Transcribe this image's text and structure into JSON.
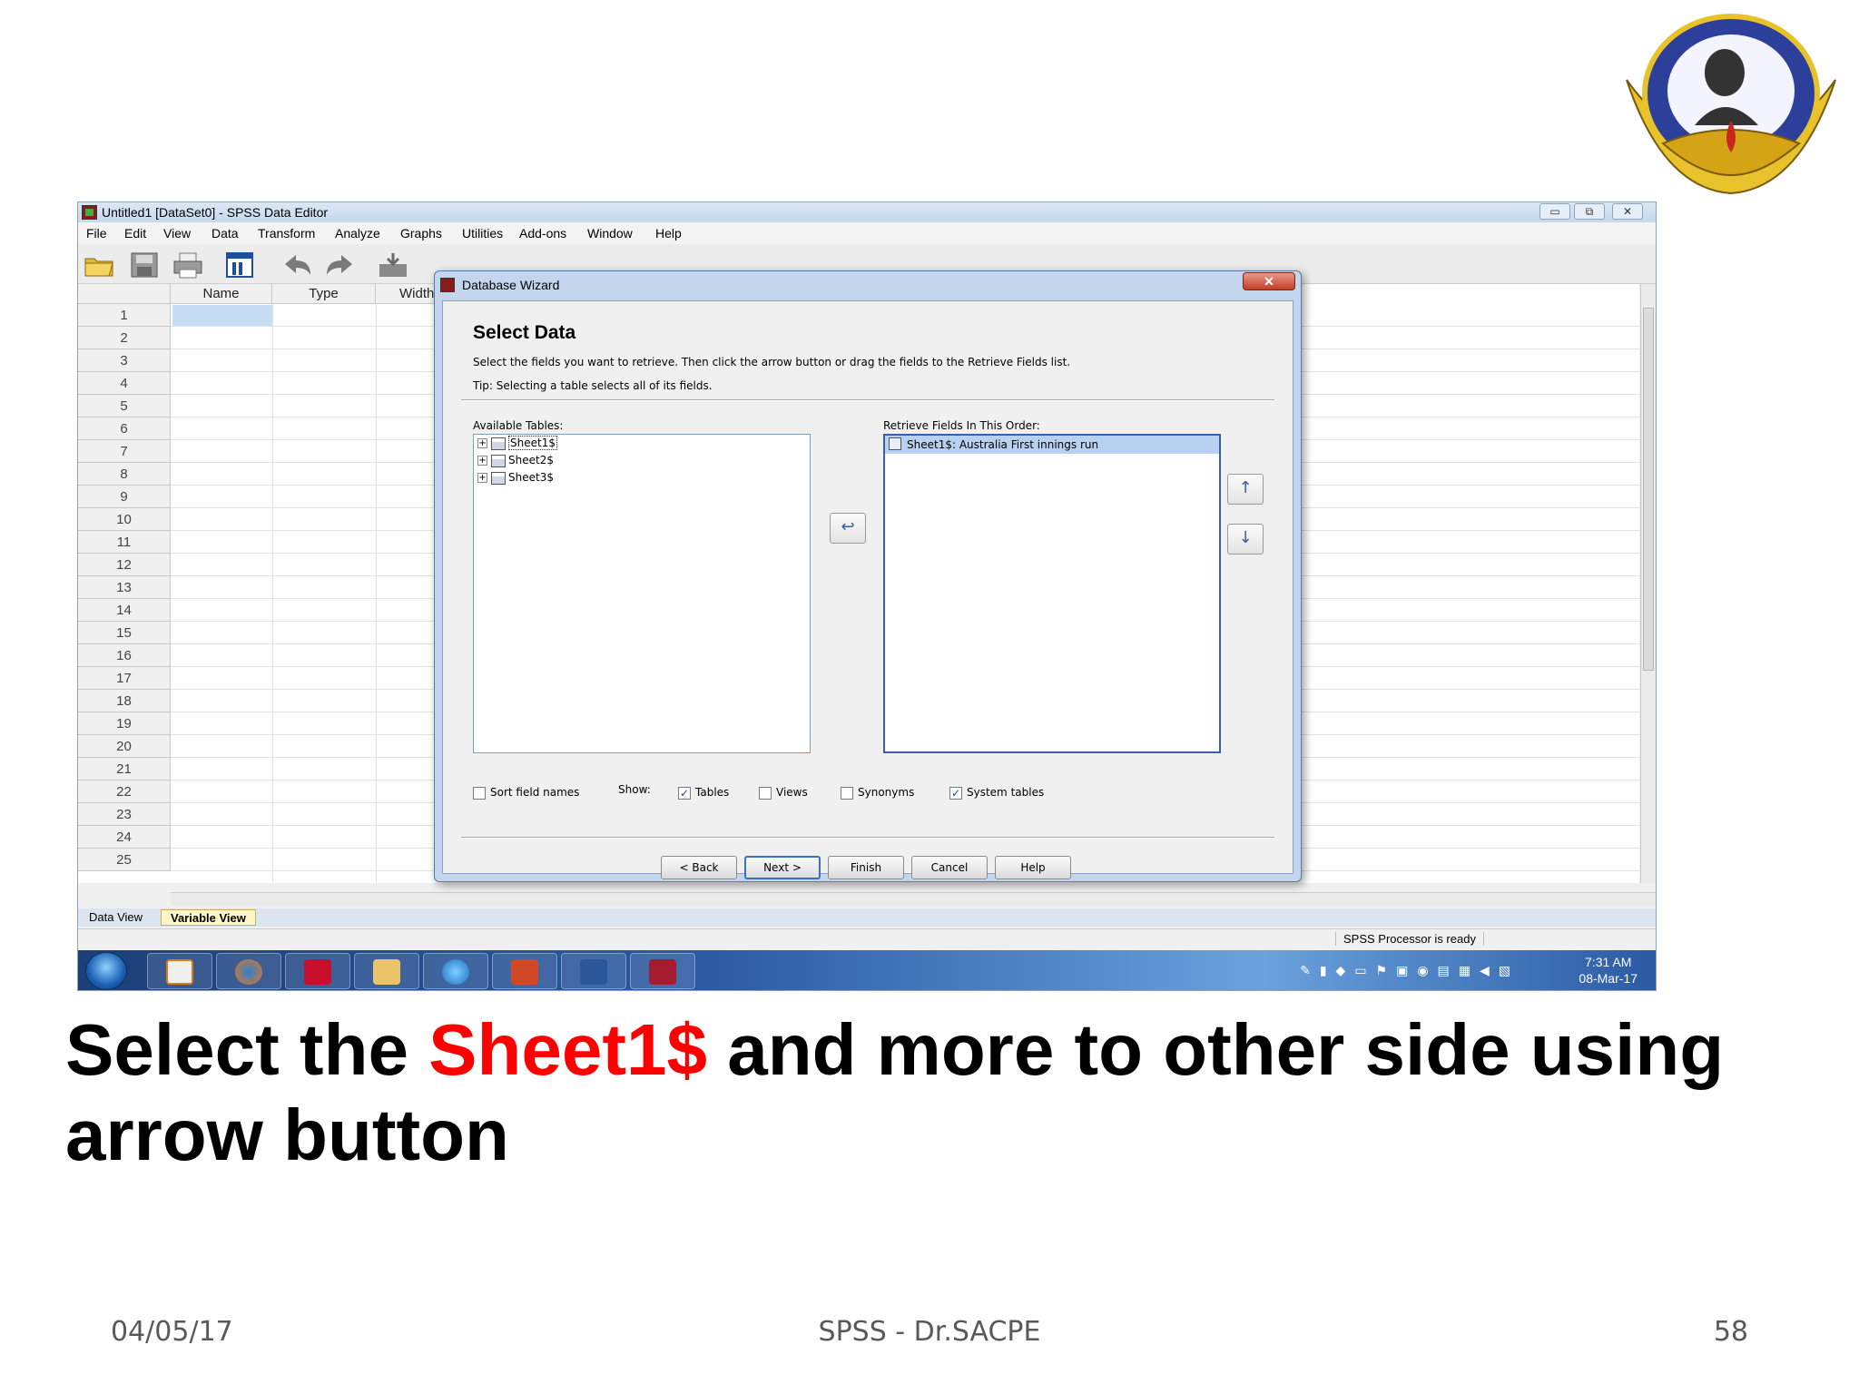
{
  "window": {
    "title": "Untitled1 [DataSet0] - SPSS Data Editor",
    "controls": [
      "▭",
      "⧉",
      "✕"
    ]
  },
  "menu": [
    "File",
    "Edit",
    "View",
    "Data",
    "Transform",
    "Analyze",
    "Graphs",
    "Utilities",
    "Add-ons",
    "Window",
    "Help"
  ],
  "grid": {
    "columns": [
      "Name",
      "Type",
      "Width"
    ],
    "rows": [
      "1",
      "2",
      "3",
      "4",
      "5",
      "6",
      "7",
      "8",
      "9",
      "10",
      "11",
      "12",
      "13",
      "14",
      "15",
      "16",
      "17",
      "18",
      "19",
      "20",
      "21",
      "22",
      "23",
      "24",
      "25"
    ]
  },
  "tabs": {
    "data_view": "Data View",
    "variable_view": "Variable View"
  },
  "status": {
    "message": "SPSS  Processor is ready"
  },
  "taskbar": {
    "time": "7:31 AM",
    "date": "08-Mar-17"
  },
  "dialog": {
    "title": "Database Wizard",
    "close": "✕",
    "heading": "Select Data",
    "description": "Select the fields you want to retrieve. Then click the arrow button or drag the fields to the Retrieve Fields list.",
    "tip": "Tip: Selecting a table selects all of its fields.",
    "available_label": "Available Tables:",
    "tables": [
      "Sheet1$",
      "Sheet2$",
      "Sheet3$"
    ],
    "retrieve_label": "Retrieve Fields In This Order:",
    "retrieve_fields": [
      "Sheet1$: Australia First innings run"
    ],
    "move_arrow": "↩",
    "up_arrow": "↑",
    "down_arrow": "↓",
    "sort_label": "Sort field names",
    "show_label": "Show:",
    "show_options": [
      {
        "label": "Tables",
        "checked": true
      },
      {
        "label": "Views",
        "checked": false
      },
      {
        "label": "Synonyms",
        "checked": false
      },
      {
        "label": "System tables",
        "checked": true
      }
    ],
    "check_mark": "✓",
    "buttons": {
      "back": "< Back",
      "next": "Next >",
      "finish": "Finish",
      "cancel": "Cancel",
      "help": "Help"
    }
  },
  "slide": {
    "caption_pre": "Select the ",
    "caption_highlight": "Sheet1$",
    "caption_post": " and more to other side using arrow button",
    "footer_date": "04/05/17",
    "footer_title": "SPSS - Dr.SACPE",
    "footer_page": "58"
  },
  "colors": {
    "highlight": "#ff0000",
    "selection": "#b9d1f0"
  }
}
